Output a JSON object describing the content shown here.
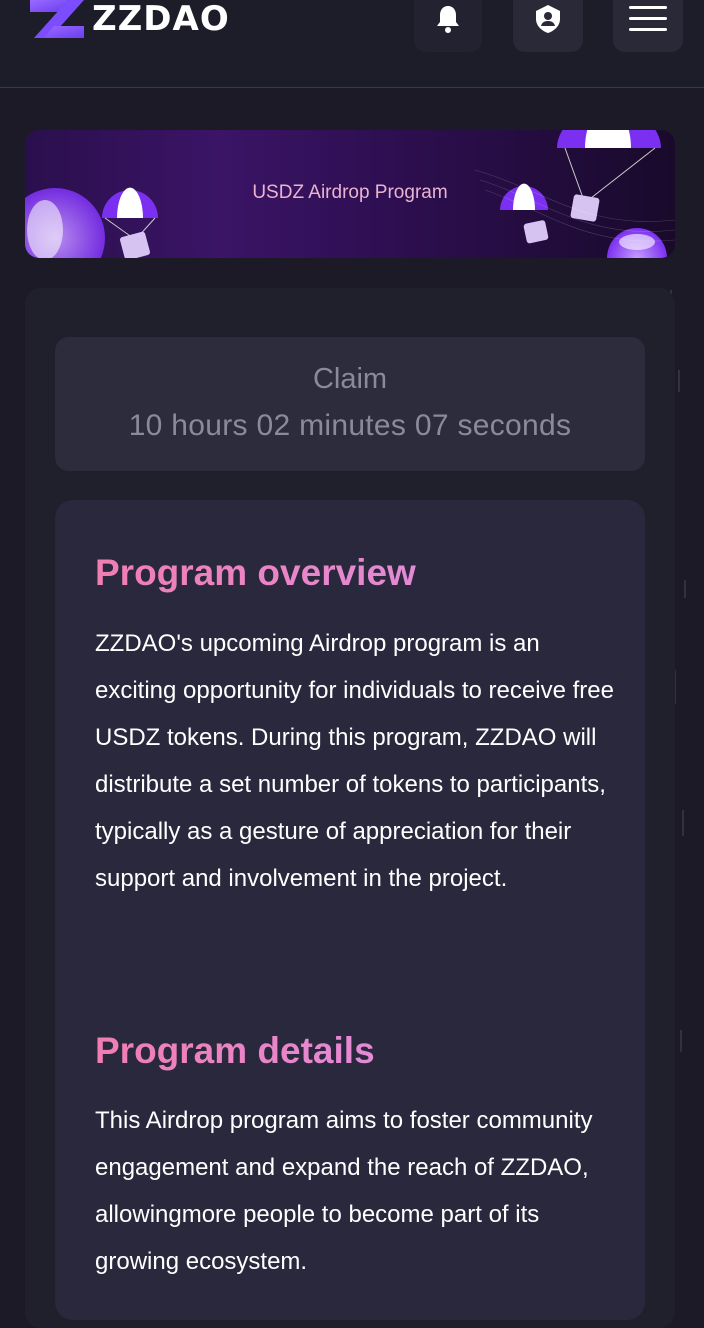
{
  "header": {
    "brand": "ZZDAO",
    "icons": [
      "bell-icon",
      "user-shield-icon",
      "hamburger-menu-icon"
    ]
  },
  "banner": {
    "title": "USDZ Airdrop Program"
  },
  "claim": {
    "label": "Claim",
    "countdown": "10 hours 02 minutes 07 seconds"
  },
  "sections": [
    {
      "title": "Program overview",
      "body": "ZZDAO's upcoming Airdrop program is an exciting opportunity for individuals to receive free USDZ tokens. During this program, ZZDAO will distribute a set number of tokens to participants, typically as a gesture of appreciation for their support and involvement in the project."
    },
    {
      "title": "Program details",
      "body": "This Airdrop program aims to foster community engagement and expand the reach of ZZDAO, allowingmore people to become part of its growing ecosystem."
    }
  ],
  "colors": {
    "accent": "#ef86bd",
    "brand_purple": "#7b4dff",
    "background": "#1b1a26"
  }
}
